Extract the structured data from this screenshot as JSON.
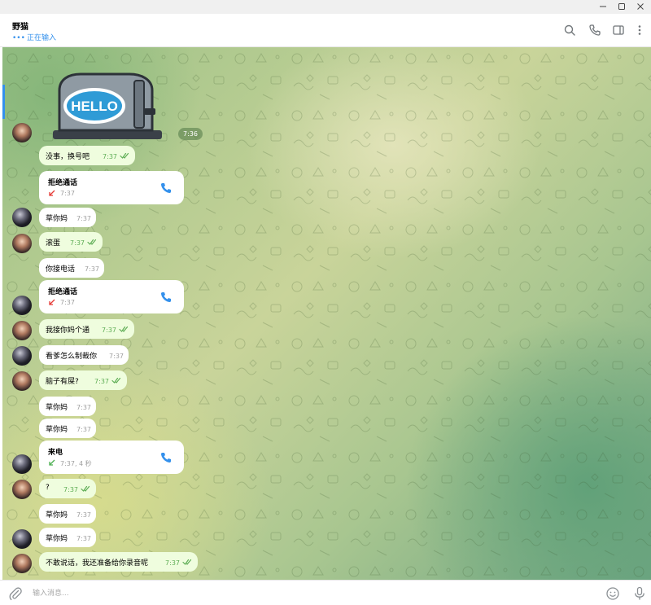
{
  "window": {
    "controls": [
      {
        "name": "minimize-button",
        "glyph": "—"
      },
      {
        "name": "maximize-button",
        "glyph": "☐"
      },
      {
        "name": "close-button",
        "glyph": "✕"
      }
    ]
  },
  "header": {
    "chat_name": "野猫",
    "status_dots": "•••",
    "status_text": "正在输入",
    "icons": [
      "search-icon",
      "phone-icon",
      "sidebar-toggle-icon",
      "more-vert-icon"
    ]
  },
  "sticker": {
    "label": "HELLO",
    "time": "7:36"
  },
  "messages": [
    {
      "kind": "text",
      "text": "没事，换号吧",
      "time": "7:37",
      "outgoing": true
    },
    {
      "kind": "call",
      "title": "拒绝通话",
      "time": "7:37",
      "direction": "declined"
    },
    {
      "kind": "text",
      "text": "草你妈",
      "time": "7:37",
      "outgoing": false
    },
    {
      "kind": "text",
      "text": "滚蛋",
      "time": "7:37",
      "outgoing": true
    },
    {
      "kind": "text",
      "text": "你接电话",
      "time": "7:37",
      "outgoing": false
    },
    {
      "kind": "call",
      "title": "拒绝通话",
      "time": "7:37",
      "direction": "declined"
    },
    {
      "kind": "text",
      "text": "我接你妈个通",
      "time": "7:37",
      "outgoing": true
    },
    {
      "kind": "text",
      "text": "看爹怎么制裁你",
      "time": "7:37",
      "outgoing": false
    },
    {
      "kind": "text",
      "text": "脑子有屎?",
      "time": "7:37",
      "outgoing": true
    },
    {
      "kind": "text",
      "text": "草你妈",
      "time": "7:37",
      "outgoing": false
    },
    {
      "kind": "text",
      "text": "草你妈",
      "time": "7:37",
      "outgoing": false
    },
    {
      "kind": "call",
      "title": "来电",
      "time": "7:37, 4 秒",
      "direction": "incoming"
    },
    {
      "kind": "text",
      "text": "?",
      "time": "7:37",
      "outgoing": true
    },
    {
      "kind": "text",
      "text": "草你妈",
      "time": "7:37",
      "outgoing": false
    },
    {
      "kind": "text",
      "text": "草你妈",
      "time": "7:37",
      "outgoing": false
    },
    {
      "kind": "text",
      "text": "不敢说话，我还准备给你录音呢",
      "time": "7:37",
      "outgoing": true
    }
  ],
  "input": {
    "placeholder": "输入消息..."
  },
  "colors": {
    "accent": "#3390ec",
    "outgoing_bubble": "#effdde",
    "incoming_bubble": "#ffffff",
    "read_check": "#5fae56",
    "declined_arrow": "#e53935",
    "incoming_arrow": "#4caf50"
  }
}
